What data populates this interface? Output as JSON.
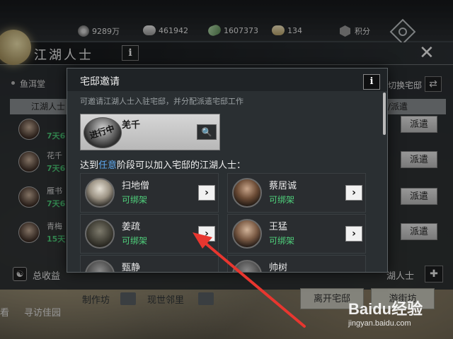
{
  "resources": [
    {
      "icon": "copper-coin-icon",
      "value": "9289万"
    },
    {
      "icon": "silver-ingot-icon",
      "value": "461942"
    },
    {
      "icon": "jade-icon",
      "value": "1607373"
    },
    {
      "icon": "gold-ingot-icon",
      "value": "134"
    },
    {
      "icon": "points-icon",
      "value": "积分"
    }
  ],
  "base_panel": {
    "title": "江湖人士",
    "info_label": "i",
    "subtitle_left": "鱼洱堂",
    "subtitle_right": "切换宅邸",
    "column_left": "江湖人士",
    "column_right": "/派遣",
    "rows": [
      {
        "name": "",
        "days": "7天6"
      },
      {
        "name": "花千",
        "days": "7天6"
      },
      {
        "name": "雁书",
        "days": "7天6"
      },
      {
        "name": "青梅",
        "days": "15天"
      }
    ],
    "dispatch_label": "派遣",
    "total_income": "总收益",
    "bottom_right": "湖人士"
  },
  "bottom_menu": {
    "workshop": "制作坊",
    "neighbor": "现世邻里",
    "visit": "寻访佳园",
    "left_tab": "看",
    "leave": "离开宅邸",
    "tour": "游街坊"
  },
  "modal": {
    "title": "宅邸邀请",
    "info_label": "i",
    "description": "可邀请江湖人士入驻宅邸，并分配派遣宅邸工作",
    "current": {
      "name": "羌千",
      "stamp": "进行中"
    },
    "stage_prefix": "达到",
    "stage_highlight": "任意",
    "stage_suffix": "阶段可以加入宅邸的江湖人士：",
    "candidates": [
      {
        "name": "扫地僧",
        "tag": "可绑架"
      },
      {
        "name": "蔡居诚",
        "tag": "可绑架"
      },
      {
        "name": "姜疏",
        "tag": "可绑架"
      },
      {
        "name": "王猛",
        "tag": "可绑架"
      },
      {
        "name": "甄静",
        "tag": ""
      },
      {
        "name": "帅树",
        "tag": ""
      }
    ]
  },
  "watermark": {
    "main": "Baidu经验",
    "sub": "jingyan.baidu.com"
  },
  "colors": {
    "highlight_blue": "#5fa8ef",
    "green_tag": "#4fd07b",
    "arrow_red": "#e8362f"
  }
}
